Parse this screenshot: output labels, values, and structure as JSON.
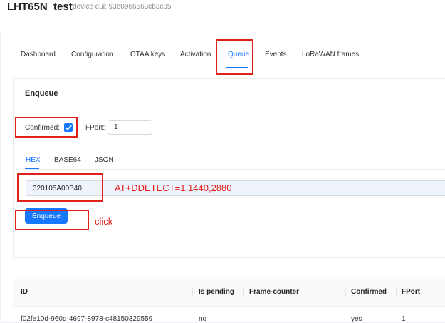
{
  "device": {
    "name": "LHT65N_test",
    "eui_text": "device eui: 93b0966563cb3c85"
  },
  "tabs": [
    {
      "label": "Dashboard",
      "active": false
    },
    {
      "label": "Configuration",
      "active": false
    },
    {
      "label": "OTAA keys",
      "active": false
    },
    {
      "label": "Activation",
      "active": false
    },
    {
      "label": "Queue",
      "active": true
    },
    {
      "label": "Events",
      "active": false
    },
    {
      "label": "LoRaWAN frames",
      "active": false
    }
  ],
  "enqueue_card": {
    "title": "Enqueue",
    "confirmed_label": "Confirmed",
    "confirmed_colon": ":",
    "confirmed_checked": true,
    "fport_label": "FPort",
    "fport_colon": ":",
    "fport_value": "1",
    "payload_tabs": [
      {
        "label": "HEX",
        "active": true
      },
      {
        "label": "BASE64",
        "active": false
      },
      {
        "label": "JSON",
        "active": false
      }
    ],
    "payload_value": "320105A00B40",
    "enqueue_button": "Enqueue"
  },
  "annotations": {
    "command_note": "AT+DDETECT=1,1440,2880",
    "click_note": "click",
    "highlight_color": "#e0201a"
  },
  "queue_table": {
    "columns": [
      "ID",
      "Is pending",
      "Frame-counter",
      "Confirmed",
      "FPort"
    ],
    "rows": [
      {
        "id": "f02fe10d-960d-4697-8978-c48150329559",
        "is_pending": "no",
        "frame_counter": "",
        "confirmed": "yes",
        "fport": "1"
      }
    ]
  },
  "colors": {
    "accent": "#1677ff",
    "page_bg": "#f0f2f5",
    "input_highlight_bg": "#eef3fc"
  }
}
